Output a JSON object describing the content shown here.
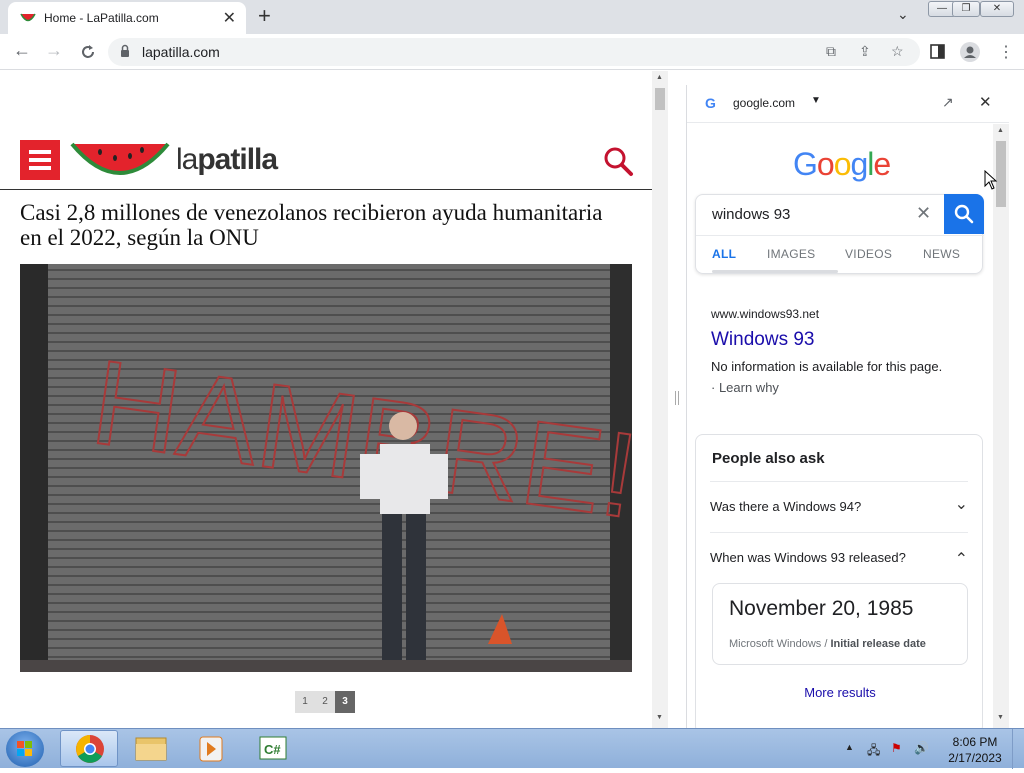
{
  "browser": {
    "tab_title": "Home - LaPatilla.com",
    "tab_close": "✕",
    "new_tab": "+",
    "tab_search": "⌄",
    "window_controls": {
      "minimize": "—",
      "restore": "❐",
      "close": "✕"
    },
    "url": "lapatilla.com"
  },
  "site": {
    "logo_light": "la",
    "logo_bold": "patilla",
    "headline": "Casi 2,8 millones de venezolanos recibieron ayuda humanitaria en el 2022, según la ONU",
    "photo_graffiti": "HAMBRE!!",
    "pages": [
      "1",
      "2",
      "3"
    ],
    "active_page": "3"
  },
  "side_panel": {
    "site": "google.com",
    "google_g": "G",
    "google_logo": [
      "G",
      "o",
      "o",
      "g",
      "l",
      "e"
    ],
    "logo_colors": [
      "#4285F4",
      "#EA4335",
      "#FBBC05",
      "#4285F4",
      "#34A853",
      "#EA4335"
    ],
    "query": "windows 93",
    "tabs": [
      "ALL",
      "IMAGES",
      "VIDEOS",
      "NEWS"
    ],
    "active_tab": "ALL",
    "result": {
      "cite": "www.windows93.net",
      "title": "Windows 93",
      "snippet": "No information is available for this page.",
      "learn": "· Learn why"
    },
    "paa": {
      "heading": "People also ask",
      "questions": [
        "Was there a Windows 94?",
        "When was Windows 93 released?"
      ],
      "answer": "November 20, 1985",
      "answer_source": "Microsoft Windows / ",
      "answer_attr": "Initial release date",
      "more": "More results"
    }
  },
  "taskbar": {
    "time": "8:06 PM",
    "date": "2/17/2023",
    "tray_arrow": "▲"
  },
  "colors": {
    "brand_red": "#e3232c",
    "google_blue": "#1a73e8",
    "link_blue": "#1a0dab"
  }
}
